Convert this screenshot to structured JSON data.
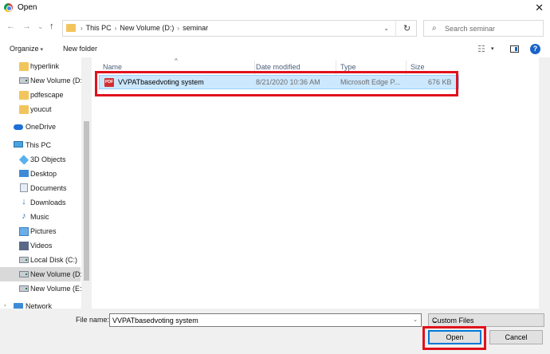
{
  "window": {
    "title": "Open",
    "close_glyph": "✕",
    "app_icon": "chrome-icon"
  },
  "nav": {
    "back_glyph": "←",
    "forward_glyph": "→",
    "recent_glyph": "⌄",
    "up_glyph": "↑"
  },
  "address": {
    "segments": [
      "This PC",
      "New Volume (D:)",
      "seminar"
    ],
    "separator": "›",
    "dropdown_glyph": "⌄",
    "refresh_glyph": "↻"
  },
  "search": {
    "placeholder": "Search seminar",
    "value": "",
    "icon_glyph": "⌕"
  },
  "toolbar": {
    "organize": "Organize",
    "new_folder": "New folder",
    "caret": "▾",
    "help": "?"
  },
  "sidebar": {
    "items": [
      {
        "label": "hyperlink",
        "icon": "folder"
      },
      {
        "label": "New Volume (D:",
        "icon": "drive"
      },
      {
        "label": "pdfescape",
        "icon": "folder"
      },
      {
        "label": "youcut",
        "icon": "folder"
      },
      {
        "label": "OneDrive",
        "icon": "cloud"
      },
      {
        "label": "This PC",
        "icon": "pc"
      },
      {
        "label": "3D Objects",
        "icon": "cube"
      },
      {
        "label": "Desktop",
        "icon": "desktop"
      },
      {
        "label": "Documents",
        "icon": "doc"
      },
      {
        "label": "Downloads",
        "icon": "down"
      },
      {
        "label": "Music",
        "icon": "music"
      },
      {
        "label": "Pictures",
        "icon": "pic"
      },
      {
        "label": "Videos",
        "icon": "vid"
      },
      {
        "label": "Local Disk (C:)",
        "icon": "drive"
      },
      {
        "label": "New Volume (D:",
        "icon": "drive",
        "selected": true
      },
      {
        "label": "New Volume (E:)",
        "icon": "drive"
      },
      {
        "label": "Network",
        "icon": "net"
      }
    ],
    "expander_glyph": "›"
  },
  "columns": {
    "sort_glyph": "^",
    "name": "Name",
    "date": "Date modified",
    "type": "Type",
    "size": "Size"
  },
  "files": [
    {
      "name": "VVPATbasedvoting system",
      "date": "8/21/2020 10:36 AM",
      "type": "Microsoft Edge P...",
      "size": "676 KB",
      "icon_label": "PDF"
    }
  ],
  "footer": {
    "file_name_label": "File name:",
    "file_name_value": "VVPATbasedvoting system",
    "file_type": "Custom Files",
    "open": "Open",
    "cancel": "Cancel",
    "caret": "⌄"
  },
  "colors": {
    "highlight": "#e0121c",
    "selection": "#cce8ff",
    "accent": "#0078d7"
  }
}
